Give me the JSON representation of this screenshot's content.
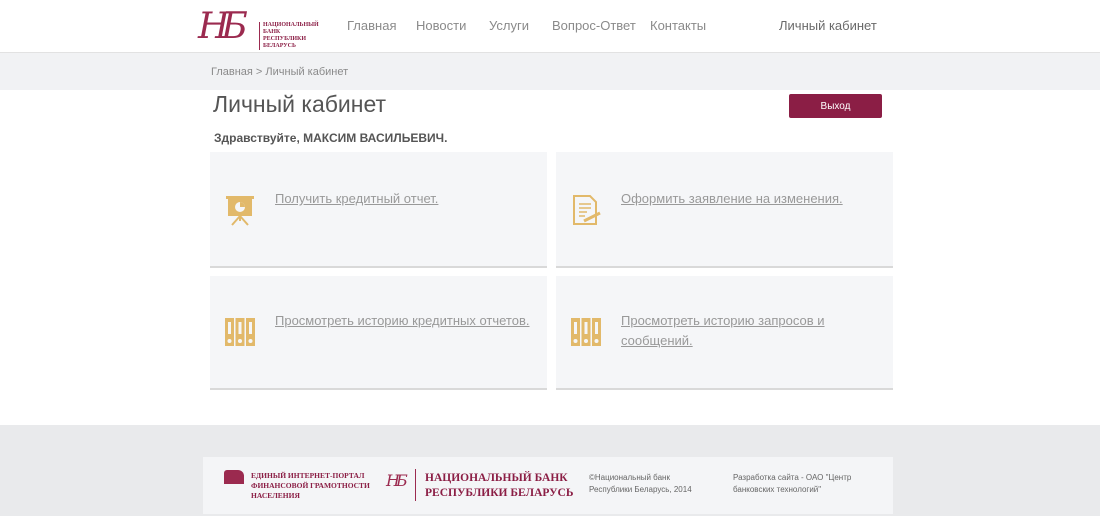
{
  "header": {
    "logo_text": [
      "НАЦИОНАЛЬНЫЙ",
      "БАНК",
      "РЕСПУБЛИКИ",
      "БЕЛАРУСЬ"
    ],
    "nav": [
      "Главная",
      "Новости",
      "Услуги",
      "Вопрос-Ответ",
      "Контакты"
    ],
    "cabinet": "Личный кабинет"
  },
  "breadcrumb": "Главная > Личный кабинет",
  "page": {
    "title": "Личный кабинет",
    "logout": "Выход",
    "greeting": "Здравствуйте, МАКСИМ ВАСИЛЬЕВИЧ."
  },
  "cards": [
    {
      "label": "Получить кредитный отчет.",
      "icon": "presentation-board-icon"
    },
    {
      "label": "Оформить заявление на изменения.",
      "icon": "document-pen-icon"
    },
    {
      "label": "Просмотреть историю кредитных отчетов.",
      "icon": "binders-icon"
    },
    {
      "label": "Просмотреть историю запросов и сообщений.",
      "icon": "binders-icon"
    }
  ],
  "footer": {
    "portal": [
      "ЕДИНЫЙ ИНТЕРНЕТ-ПОРТАЛ",
      "ФИНАНСОВОЙ ГРАМОТНОСТИ",
      "НАСЕЛЕНИЯ"
    ],
    "bank": [
      "НАЦИОНАЛЬНЫЙ БАНК",
      "РЕСПУБЛИКИ БЕЛАРУСЬ"
    ],
    "copyright": [
      "©Национальный банк",
      "Республики Беларусь, 2014"
    ],
    "dev": [
      "Разработка сайта - ОАО \"Центр",
      "банковских технологий\""
    ]
  },
  "colors": {
    "accent": "#8b1e45",
    "icon": "#e2b96a"
  }
}
